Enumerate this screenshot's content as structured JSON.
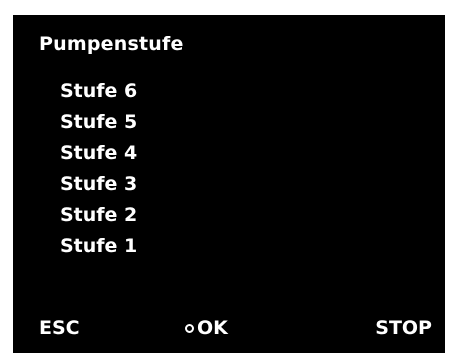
{
  "screen": {
    "title": "Pumpenstufe",
    "menu_items": [
      {
        "label": "Stufe 6"
      },
      {
        "label": "Stufe 5"
      },
      {
        "label": "Stufe 4"
      },
      {
        "label": "Stufe 3"
      },
      {
        "label": "Stufe 2"
      },
      {
        "label": "Stufe 1"
      }
    ]
  },
  "softkeys": {
    "esc_label": "ESC",
    "ok_label": "OK",
    "ok_icon": "ring-icon",
    "stop_label": "STOP"
  },
  "colors": {
    "screen_background": "#000000",
    "text": "#ffffff"
  }
}
